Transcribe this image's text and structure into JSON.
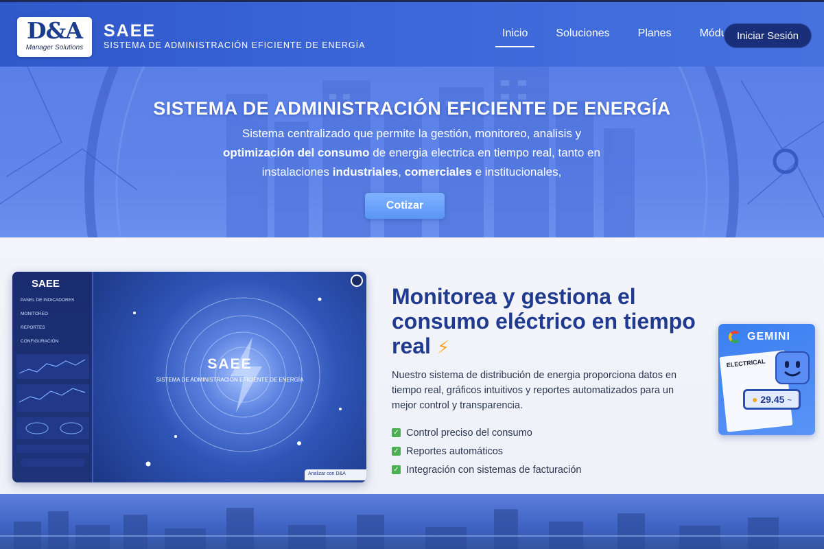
{
  "nav": {
    "logo": {
      "mark": "D&A",
      "sub": "Manager Solutions"
    },
    "brand_title": "SAEE",
    "brand_subtitle": "SISTEMA DE ADMINISTRACIÓN EFICIENTE DE ENERGÍA",
    "links": [
      "Inicio",
      "Soluciones",
      "Planes",
      "Módulos"
    ],
    "active_link": "Inicio",
    "login_label": "Iniciar Sesión"
  },
  "hero": {
    "title": "SISTEMA DE ADMINISTRACIÓN EFICIENTE DE ENERGÍA",
    "text_1": "Sistema centralizado que permite la gestión, monitoreo, analisis y",
    "text_2_bold": "optimización del consumo",
    "text_2_rest": " de energia electrica en tiempo real, tanto en",
    "text_3_pre": "instalaciones ",
    "text_3_b1": "industriales",
    "text_3_mid": ", ",
    "text_3_b2": "comerciales",
    "text_3_rest": " e institucionales,",
    "cta_label": "Cotizar"
  },
  "mockup": {
    "side_title": "SAEE",
    "side_labels": [
      "PANEL DE INDICADORES",
      "MONITOREO",
      "REPORTES",
      "CONFIGURACIÓN"
    ],
    "main_title": "SAEE",
    "main_subtitle": "SISTEMA DE ADMINISTRACIÓN EFICIENTE DE ENERGÍA",
    "tag": "Analizar con D&A"
  },
  "feature": {
    "title": "Monitorea y gestiona el consumo eléctrico en tiempo real",
    "bolt_icon": "⚡",
    "description": "Nuestro sistema de distribución de energia proporciona datos en tiempo real, gráficos intuitivos y reportes automatizados para un mejor control y transparencia.",
    "items": [
      "Control preciso del consumo",
      "Reportes automáticos",
      "Integración con sistemas de facturación"
    ]
  },
  "gemini_card": {
    "title": "GEMINI",
    "paper_label": "ELECTRICAL",
    "meter_value": "29.45",
    "meter_suffix": "~"
  },
  "colors": {
    "nav_bg": "#3a66d8",
    "hero_bg": "#5f85ea",
    "title_blue": "#1f3a8f",
    "cta": "#6aa3fb",
    "check": "#4caf50",
    "login_bg": "#1a2f7a"
  }
}
